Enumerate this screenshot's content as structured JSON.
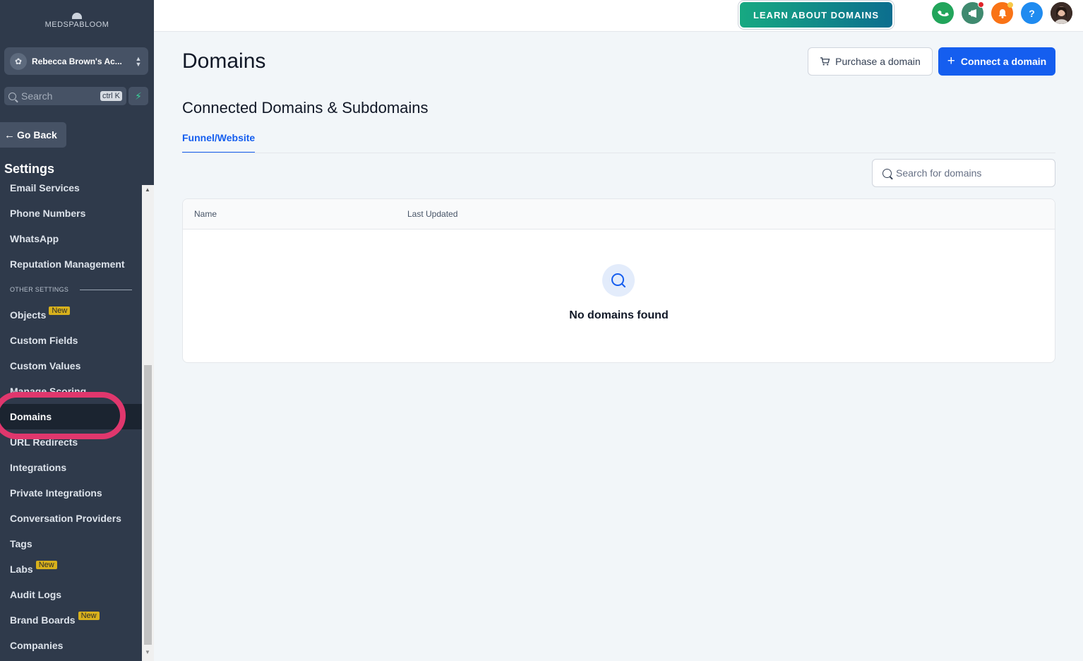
{
  "brand": {
    "logo_text": "MEDSPABLOOM"
  },
  "account": {
    "name": "Rebecca Brown's Ac...",
    "avatar_glyph": "✿"
  },
  "sidebar_search": {
    "placeholder": "Search",
    "shortcut": "ctrl K"
  },
  "go_back_label": "Go Back",
  "settings_title": "Settings",
  "nav": {
    "email_services": "Email Services",
    "phone_numbers": "Phone Numbers",
    "whatsapp": "WhatsApp",
    "reputation_management": "Reputation Management",
    "other_settings_label": "OTHER SETTINGS",
    "objects": "Objects",
    "custom_fields": "Custom Fields",
    "custom_values": "Custom Values",
    "manage_scoring": "Manage Scoring",
    "domains": "Domains",
    "url_redirects": "URL Redirects",
    "integrations": "Integrations",
    "private_integrations": "Private Integrations",
    "conversation_providers": "Conversation Providers",
    "tags": "Tags",
    "labs": "Labs",
    "audit_logs": "Audit Logs",
    "brand_boards": "Brand Boards",
    "companies": "Companies",
    "new_badge": "New"
  },
  "topbar": {
    "learn_label": "LEARN ABOUT DOMAINS",
    "help_glyph": "?",
    "colors": {
      "phone": "#22a55b",
      "megaphone": "#3f8a6f",
      "bell": "#f97316",
      "help": "#1f8bf0"
    }
  },
  "page": {
    "title": "Domains",
    "purchase_label": "Purchase a domain",
    "connect_label": "Connect a domain",
    "section_title": "Connected Domains & Subdomains",
    "tab_label": "Funnel/Website",
    "search_placeholder": "Search for domains",
    "columns": [
      "Name",
      "Last Updated"
    ],
    "empty_text": "No domains found"
  },
  "accent_color": "#155eef"
}
